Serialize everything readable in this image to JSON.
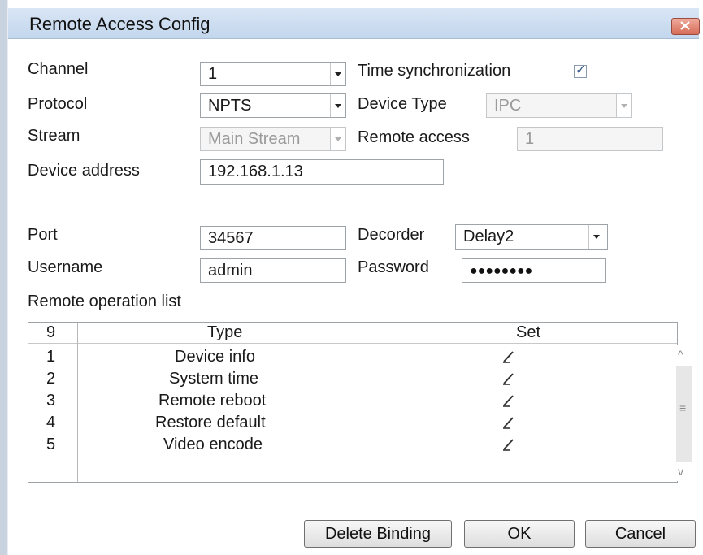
{
  "window": {
    "title": "Remote Access Config"
  },
  "form": {
    "channel_label": "Channel",
    "channel_value": "1",
    "time_sync_label": "Time synchronization",
    "time_sync_checked": true,
    "protocol_label": "Protocol",
    "protocol_value": "NPTS",
    "device_type_label": "Device Type",
    "device_type_value": "IPC",
    "stream_label": "Stream",
    "stream_value": "Main Stream",
    "remote_access_label": "Remote access",
    "remote_access_value": "1",
    "device_address_label": "Device address",
    "device_address_value": "192.168.1.13",
    "port_label": "Port",
    "port_value": "34567",
    "decoder_label": "Decorder",
    "decoder_value": "Delay2",
    "username_label": "Username",
    "username_value": "admin",
    "password_label": "Password",
    "password_mask": "●●●●●●●●"
  },
  "operations": {
    "group_label": "Remote operation list",
    "header_index": "9",
    "header_type": "Type",
    "header_set": "Set",
    "rows": [
      {
        "index": "1",
        "type": "Device info"
      },
      {
        "index": "2",
        "type": "System time"
      },
      {
        "index": "3",
        "type": "Remote reboot"
      },
      {
        "index": "4",
        "type": "Restore default"
      },
      {
        "index": "5",
        "type": "Video encode"
      }
    ]
  },
  "buttons": {
    "delete_binding": "Delete Binding",
    "ok": "OK",
    "cancel": "Cancel"
  },
  "icons": {
    "close": "close-icon",
    "edit": "pencil-edit-icon",
    "scroll_up": "chevron-up-icon",
    "scroll_down": "chevron-down-icon"
  }
}
